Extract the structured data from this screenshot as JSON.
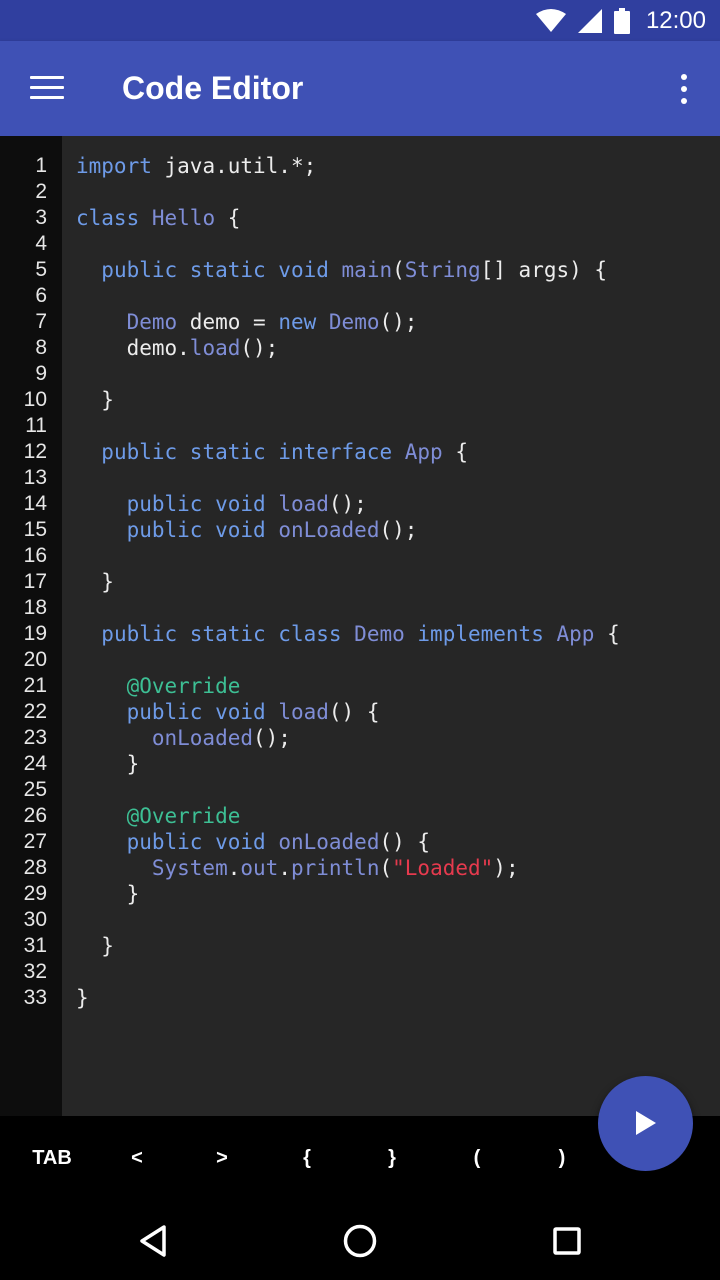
{
  "status_bar": {
    "time": "12:00"
  },
  "app_bar": {
    "title": "Code Editor"
  },
  "editor": {
    "lines": [
      {
        "num": "1",
        "tokens": [
          [
            "kw",
            "import"
          ],
          [
            "",
            "java.util.*;"
          ]
        ],
        "indent": 0,
        "raw_sep": true
      },
      {
        "num": "2",
        "tokens": []
      },
      {
        "num": "3",
        "tokens": [
          [
            "kw",
            "class"
          ],
          [
            "",
            " "
          ],
          [
            "ty",
            "Hello"
          ],
          [
            "",
            " {"
          ]
        ]
      },
      {
        "num": "4",
        "tokens": []
      },
      {
        "num": "5",
        "tokens": [
          [
            "",
            "  "
          ],
          [
            "kw",
            "public static void"
          ],
          [
            "",
            " "
          ],
          [
            "fn",
            "main"
          ],
          [
            "",
            "("
          ],
          [
            "ty",
            "String"
          ],
          [
            "",
            "[] args) {"
          ]
        ]
      },
      {
        "num": "6",
        "tokens": []
      },
      {
        "num": "7",
        "tokens": [
          [
            "",
            "    "
          ],
          [
            "ty",
            "Demo"
          ],
          [
            "",
            " demo = "
          ],
          [
            "kw",
            "new"
          ],
          [
            "",
            " "
          ],
          [
            "ty",
            "Demo"
          ],
          [
            "",
            "();"
          ]
        ]
      },
      {
        "num": "8",
        "tokens": [
          [
            "",
            "    demo."
          ],
          [
            "fn",
            "load"
          ],
          [
            "",
            "();"
          ]
        ]
      },
      {
        "num": "9",
        "tokens": []
      },
      {
        "num": "10",
        "tokens": [
          [
            "",
            "  }"
          ]
        ]
      },
      {
        "num": "11",
        "tokens": []
      },
      {
        "num": "12",
        "tokens": [
          [
            "",
            "  "
          ],
          [
            "kw",
            "public static interface"
          ],
          [
            "",
            " "
          ],
          [
            "ty",
            "App"
          ],
          [
            "",
            " {"
          ]
        ]
      },
      {
        "num": "13",
        "tokens": []
      },
      {
        "num": "14",
        "tokens": [
          [
            "",
            "    "
          ],
          [
            "kw",
            "public void"
          ],
          [
            "",
            " "
          ],
          [
            "fn",
            "load"
          ],
          [
            "",
            "();"
          ]
        ]
      },
      {
        "num": "15",
        "tokens": [
          [
            "",
            "    "
          ],
          [
            "kw",
            "public void"
          ],
          [
            "",
            " "
          ],
          [
            "fn",
            "onLoaded"
          ],
          [
            "",
            "();"
          ]
        ]
      },
      {
        "num": "16",
        "tokens": []
      },
      {
        "num": "17",
        "tokens": [
          [
            "",
            "  }"
          ]
        ]
      },
      {
        "num": "18",
        "tokens": []
      },
      {
        "num": "19",
        "tokens": [
          [
            "",
            "  "
          ],
          [
            "kw",
            "public static class"
          ],
          [
            "",
            " "
          ],
          [
            "ty",
            "Demo"
          ],
          [
            "",
            " "
          ],
          [
            "kw",
            "implements"
          ],
          [
            "",
            " "
          ],
          [
            "ty",
            "App"
          ],
          [
            "",
            " {"
          ]
        ]
      },
      {
        "num": "20",
        "tokens": []
      },
      {
        "num": "21",
        "tokens": [
          [
            "",
            "    "
          ],
          [
            "an",
            "@Override"
          ]
        ]
      },
      {
        "num": "22",
        "tokens": [
          [
            "",
            "    "
          ],
          [
            "kw",
            "public void"
          ],
          [
            "",
            " "
          ],
          [
            "fn",
            "load"
          ],
          [
            "",
            "() {"
          ]
        ]
      },
      {
        "num": "23",
        "tokens": [
          [
            "",
            "      "
          ],
          [
            "fn",
            "onLoaded"
          ],
          [
            "",
            "();"
          ]
        ]
      },
      {
        "num": "24",
        "tokens": [
          [
            "",
            "    }"
          ]
        ]
      },
      {
        "num": "25",
        "tokens": []
      },
      {
        "num": "26",
        "tokens": [
          [
            "",
            "    "
          ],
          [
            "an",
            "@Override"
          ]
        ]
      },
      {
        "num": "27",
        "tokens": [
          [
            "",
            "    "
          ],
          [
            "kw",
            "public void"
          ],
          [
            "",
            " "
          ],
          [
            "fn",
            "onLoaded"
          ],
          [
            "",
            "() {"
          ]
        ]
      },
      {
        "num": "28",
        "tokens": [
          [
            "",
            "      "
          ],
          [
            "ty",
            "System"
          ],
          [
            "",
            "."
          ],
          [
            "ty",
            "out"
          ],
          [
            "",
            "."
          ],
          [
            "fn",
            "println"
          ],
          [
            "",
            "("
          ],
          [
            "st",
            "\"Loaded\""
          ],
          [
            "",
            ");"
          ]
        ]
      },
      {
        "num": "29",
        "tokens": [
          [
            "",
            "    }"
          ]
        ]
      },
      {
        "num": "30",
        "tokens": []
      },
      {
        "num": "31",
        "tokens": [
          [
            "",
            "  }"
          ]
        ]
      },
      {
        "num": "32",
        "tokens": []
      },
      {
        "num": "33",
        "tokens": [
          [
            "",
            "}"
          ]
        ]
      }
    ]
  },
  "key_bar": {
    "keys": [
      "TAB",
      "<",
      ">",
      "{",
      "}",
      "(",
      ")"
    ]
  },
  "run_button": {
    "icon": "play-icon"
  },
  "colors": {
    "status_bar": "#303f9f",
    "app_bar": "#3f51b5",
    "editor_bg": "#262626",
    "keyword": "#6e9be8",
    "annotation": "#3dbf94",
    "string": "#e63a4e"
  }
}
